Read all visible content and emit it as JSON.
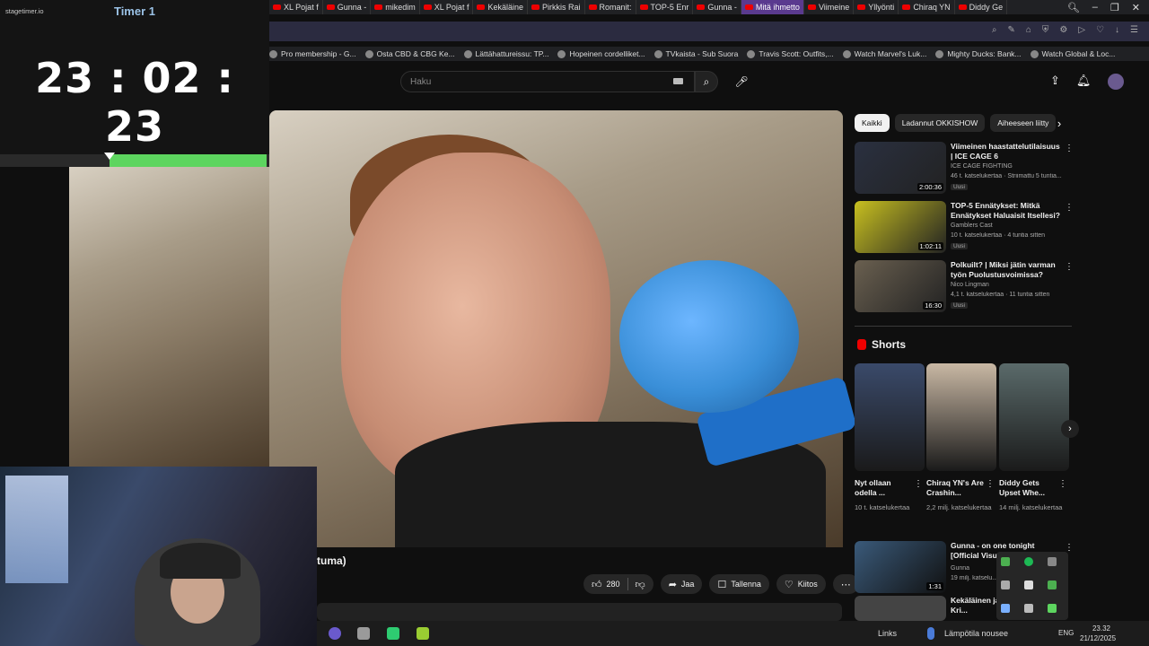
{
  "timer": {
    "brand": "stagetimer.io",
    "title": "Timer 1",
    "value": "23 : 02 : 23",
    "progress_percent": 59
  },
  "browser": {
    "tabs": [
      "XL Pojat f",
      "Gunna - ",
      "mikedim",
      "XL Pojat f",
      "Kekäläine",
      "Pirkkis Rai",
      "Romanit:",
      "TOP-5 Enr",
      "Gunna - ",
      "Mitä ihmetto",
      "Viimeine",
      "Yllyönti",
      "Chiraq YN",
      "Diddy Ge"
    ],
    "active_tab": "Mitä ihmetto",
    "bookmarks": [
      "Pro membership - G...",
      "Osta CBD & CBG Ke...",
      "Lättähattureissu: TP...",
      "Hopeinen cordelliket...",
      "TVkaista - Sub Suora",
      "Travis Scott: Outfits,...",
      "Watch Marvel's Luk...",
      "Mighty Ducks: Bank...",
      "Watch Global & Loc..."
    ]
  },
  "youtube": {
    "search_placeholder": "Haku",
    "video_title_fragment": "tuma)",
    "likes": "280",
    "share_label": "Jaa",
    "save_label": "Tallenna",
    "thanks_label": "Kiitos",
    "chips": [
      "Kaikki",
      "Ladannut OKKISHOW",
      "Aiheeseen liitty"
    ],
    "suggestions": [
      {
        "title": "Viimeinen haastattelutilaisuus | ICE CAGE 6",
        "channel": "ICE CAGE FIGHTING",
        "stats": "46 t. katselukertaa · Striimattu 5 tuntia...",
        "duration": "2:00:36",
        "badge": "Uusi",
        "thumb_color": "#2a3040"
      },
      {
        "title": "TOP-5 Ennätykset: Mitkä Ennätykset Haluaisit Itsellesi?",
        "channel": "Gamblers Cast",
        "stats": "10 t. katselukertaa · 4 tuntia sitten",
        "duration": "1:02:11",
        "badge": "Uusi",
        "thumb_color": "#c8c020"
      },
      {
        "title": "Polkuilt? | Miksi jätin varman työn Puolustusvoimissa?",
        "channel": "Nico Lingman",
        "stats": "4,1 t. katselukertaa · 11 tuntia sitten",
        "duration": "16:30",
        "badge": "Uusi",
        "thumb_color": "#6a6050"
      }
    ],
    "shorts_header": "Shorts",
    "shorts": [
      {
        "title": "Nyt ollaan odella ...",
        "views": "10 t. katselukertaa",
        "thumb_color": "#3a4a6a"
      },
      {
        "title": "Chiraq YN's Are Crashin...",
        "views": "2,2 milj. katselukertaa",
        "thumb_color": "#c9b8a4"
      },
      {
        "title": "Diddy Gets Upset Whe...",
        "views": "14 milj. katselukertaa",
        "thumb_color": "#5a6a6a"
      }
    ],
    "bottom_suggestion": {
      "title": "Gunna - on one tonight [Official Visualizer]",
      "channel": "Gunna",
      "stats": "19 milj. katselu...",
      "duration": "1:31",
      "thumb_color": "#3a5a7a"
    },
    "bottom_suggestion_2": {
      "title": "Kekäläinen ja ... Toronton Kri...",
      "thumb_color": "#444"
    }
  },
  "taskbar": {
    "links_label": "Links",
    "weather_label": "Lämpötila nousee",
    "lang": "ENG",
    "time": "23.32",
    "date": "21/12/2025"
  }
}
